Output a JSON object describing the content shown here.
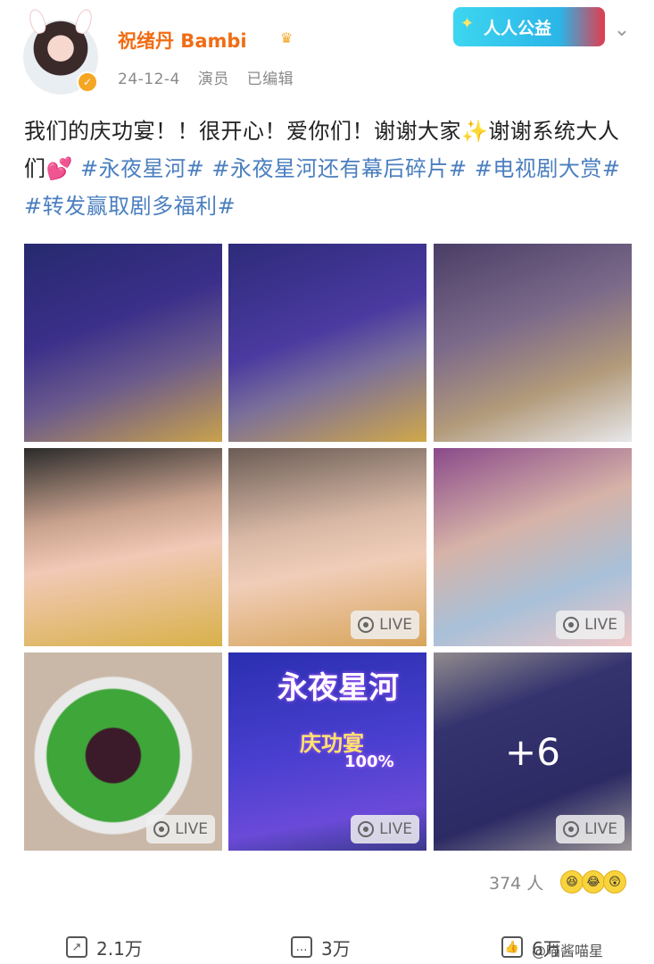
{
  "header": {
    "username": "祝绪丹 Bambi",
    "date": "24-12-4",
    "role": "演员",
    "edited": "已编辑",
    "charity_label": "人人公益"
  },
  "post": {
    "text_plain": "我们的庆功宴！！很开心！爱你们！谢谢大家✨谢谢系统大人们💕",
    "hashtags": [
      "#永夜星河#",
      "#永夜星河还有幕后碎片#",
      "#电视剧大赏#",
      "#转发赢取剧多福利#"
    ]
  },
  "grid": {
    "live_label": "LIVE",
    "more_label": "+6",
    "poster_title": "永夜星河",
    "poster_sub": "庆功宴",
    "poster_pct": "100%"
  },
  "reactions": {
    "count": "374 人"
  },
  "actions": {
    "repost": "2.1万",
    "comment": "3万",
    "like": "6万"
  },
  "watermark": "@喵酱喵星",
  "colors": {
    "username": "#f06d15",
    "hashtag": "#4b7fbf"
  }
}
